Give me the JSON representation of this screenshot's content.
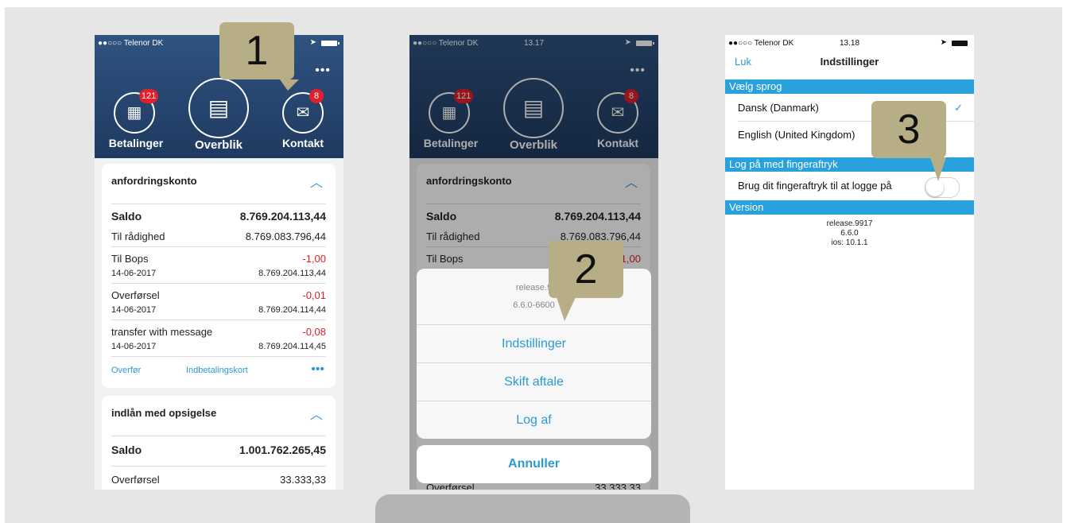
{
  "colors": {
    "brand": "#1f3a60",
    "accent": "#2a9ad6",
    "negative": "#e0202a",
    "callout": "#b7ae86",
    "section": "#29a1dc"
  },
  "status": {
    "carrier": "●●○○○ Telenor DK",
    "times": [
      "13.17",
      "13.17",
      "13.18"
    ]
  },
  "header": {
    "more": "•••",
    "nav": [
      {
        "label": "Betalinger",
        "badge": "121",
        "icon": "payments-icon"
      },
      {
        "label": "Overblik",
        "icon": "overview-icon"
      },
      {
        "label": "Kontakt",
        "badge": "8",
        "icon": "mail-icon"
      }
    ]
  },
  "account1": {
    "name": "anfordringskonto",
    "saldo_label": "Saldo",
    "saldo_value": "8.769.204.113,44",
    "avail_label": "Til rådighed",
    "avail_value": "8.769.083.796,44",
    "tx": [
      {
        "title": "Til Bops",
        "date": "14-06-2017",
        "amount": "-1,00",
        "balance": "8.769.204.113,44"
      },
      {
        "title": "Overførsel",
        "date": "14-06-2017",
        "amount": "-0,01",
        "balance": "8.769.204.114,44"
      },
      {
        "title": "transfer with message",
        "date": "14-06-2017",
        "amount": "-0,08",
        "balance": "8.769.204.114,45"
      }
    ],
    "actions": {
      "transfer": "Overfør",
      "card": "Indbetalingskort",
      "more": "•••"
    }
  },
  "account2": {
    "name": "indlån med opsigelse",
    "saldo_label": "Saldo",
    "saldo_value": "1.001.762.265,45",
    "last_title": "Overførsel",
    "last_amount": "33.333,33"
  },
  "action_sheet": {
    "version": "release.9",
    "build": "6.6.0-6600",
    "items": [
      "Indstillinger",
      "Skift aftale",
      "Log af"
    ],
    "cancel": "Annuller"
  },
  "callouts": [
    "1",
    "2",
    "3"
  ],
  "settings": {
    "close": "Luk",
    "title": "Indstillinger",
    "language_section": "Vælg sprog",
    "languages": [
      "Dansk (Danmark)",
      "English (United Kingdom)"
    ],
    "check": "✓",
    "finger_section": "Log på med fingeraftryk",
    "finger_label": "Brug dit fingeraftryk til at logge på",
    "version_section": "Version",
    "version_lines": [
      "release.9917",
      "6.6.0",
      "ios: 10.1.1"
    ]
  }
}
